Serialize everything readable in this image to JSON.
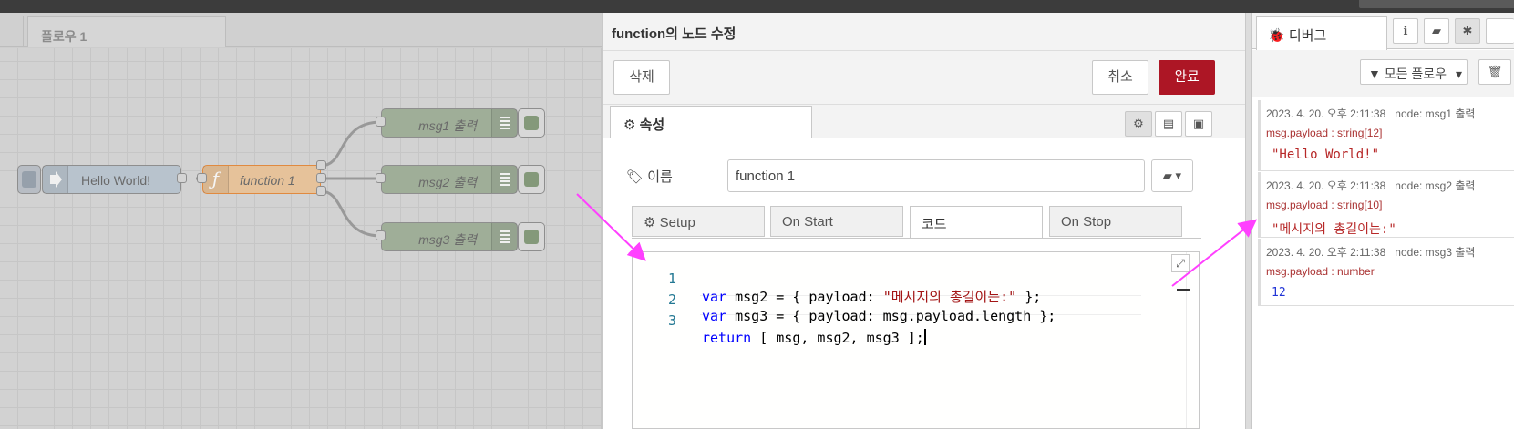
{
  "workspace": {
    "flow_tab": "플로우 1",
    "nodes": {
      "inject": {
        "label": "Hello World!"
      },
      "function": {
        "label": "function 1",
        "icon": "ƒ"
      },
      "debug1": {
        "label": "msg1 출력"
      },
      "debug2": {
        "label": "msg2 출력"
      },
      "debug3": {
        "label": "msg3 출력"
      }
    },
    "colors": {
      "inject": "#a6bbcf",
      "function": "#fdd0a2",
      "debug": "#87a980",
      "function_border": "#f58d36"
    }
  },
  "tray": {
    "title": "function의 노드 수정",
    "delete_label": "삭제",
    "cancel_label": "취소",
    "done_label": "완료",
    "properties_tab": "속성",
    "name_label": "이름",
    "name_value": "function 1",
    "subtabs": {
      "setup": "Setup",
      "on_start": "On Start",
      "code": "코드",
      "on_stop": "On Stop"
    },
    "code_lines": [
      {
        "num": "1",
        "kw": "var",
        "pre": " msg2 = { payload: ",
        "str": "\"메시지의 총길이는:\"",
        "post": " };"
      },
      {
        "num": "2",
        "kw": "var",
        "pre": " msg3 = { payload: msg.payload.length };",
        "str": "",
        "post": ""
      },
      {
        "num": "3",
        "kw": "return",
        "pre": " [ msg, msg2, msg3 ];",
        "str": "",
        "post": ""
      }
    ]
  },
  "sidebar": {
    "tab_label": "디버그",
    "filter_label": "모든 플로우",
    "messages": [
      {
        "time": "2023. 4. 20. 오후 2:11:38",
        "node": "node: msg1 출력",
        "type": "msg.payload : string[12]",
        "value": "\"Hello World!\"",
        "kind": "string"
      },
      {
        "time": "2023. 4. 20. 오후 2:11:38",
        "node": "node: msg2 출력",
        "type": "msg.payload : string[10]",
        "value": "\"메시지의 총길이는:\"",
        "kind": "string"
      },
      {
        "time": "2023. 4. 20. 오후 2:11:38",
        "node": "node: msg3 출력",
        "type": "msg.payload : number",
        "value": "12",
        "kind": "number"
      }
    ]
  },
  "annotations": {
    "arrow_color": "#ff40ff"
  }
}
